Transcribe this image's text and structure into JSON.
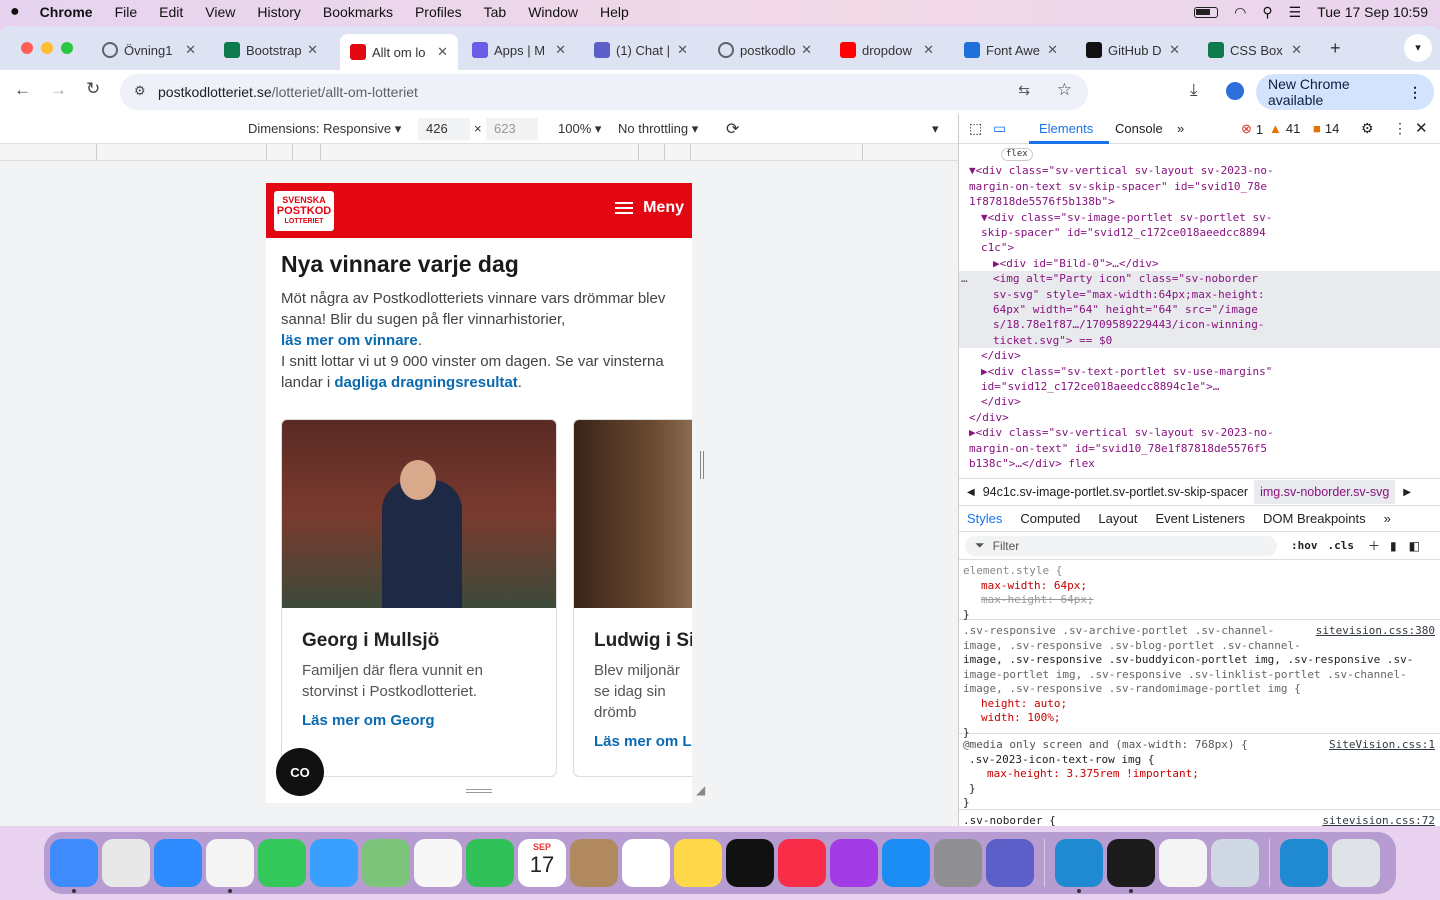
{
  "menubar": {
    "app": "Chrome",
    "items": [
      "File",
      "Edit",
      "View",
      "History",
      "Bookmarks",
      "Profiles",
      "Tab",
      "Window",
      "Help"
    ],
    "datetime": "Tue 17 Sep  10:59"
  },
  "tabs": [
    {
      "title": "Övning1",
      "icon": "globe-icon",
      "color": "#5f6368"
    },
    {
      "title": "Bootstrap",
      "icon": "w-icon",
      "color": "#0c7a4d"
    },
    {
      "title": "Allt om lo",
      "icon": "postkod-icon",
      "color": "#e30613",
      "active": true
    },
    {
      "title": "Apps | M",
      "icon": "copilot-icon",
      "color": "#6c5ce7"
    },
    {
      "title": "(1) Chat |",
      "icon": "teams-icon",
      "color": "#5b5fc7"
    },
    {
      "title": "postkodlo",
      "icon": "globe-icon",
      "color": "#5f6368"
    },
    {
      "title": "dropdow",
      "icon": "youtube-icon",
      "color": "#ff0000"
    },
    {
      "title": "Font Awe",
      "icon": "flag-icon",
      "color": "#1e6fd9"
    },
    {
      "title": "GitHub D",
      "icon": "github-icon",
      "color": "#111111"
    },
    {
      "title": "CSS Box",
      "icon": "w-icon",
      "color": "#0c7a4d"
    }
  ],
  "address": {
    "host": "postkodlotteriet.se",
    "path": "/lotteriet/allt-om-lotteriet"
  },
  "toolbar": {
    "new_chrome": "New Chrome available"
  },
  "devbar": {
    "dimensions": "Dimensions: Responsive",
    "width": "426",
    "height": "623",
    "zoom": "100%",
    "throttle": "No throttling"
  },
  "site": {
    "logo": {
      "l1": "SVENSKA",
      "l2": "POSTKOD",
      "l3": "LOTTERIET"
    },
    "menu": "Meny",
    "heading": "Nya vinnare varje dag",
    "intro1": "Möt några av Postkodlotteriets vinnare vars drömmar blev sanna! Blir du sugen på fler vinnarhistorier,",
    "link1": "läs mer om vinnare",
    "intro2": "I snitt lottar vi ut 9 000 vinster om dagen. Se var vinsterna landar i",
    "link2": "dagliga dragningsresultat",
    "cards": [
      {
        "name": "Georg i Mullsjö",
        "desc": "Familjen där flera vunnit en storvinst i Postkodlotteriet.",
        "more": "Läs mer om Georg"
      },
      {
        "name": "Ludwig i Sir",
        "desc": "Blev miljonär se idag sin drömb",
        "more": "Läs mer om Lu"
      }
    ],
    "co_button": "CO"
  },
  "devtools": {
    "tabs": [
      "Elements",
      "Console"
    ],
    "errors": "1",
    "warnings": "41",
    "issues": "14",
    "crumb1": "94c1c.sv-image-portlet.sv-portlet.sv-skip-spacer",
    "crumb2": "img.sv-noborder.sv-svg",
    "style_tabs": [
      "Styles",
      "Computed",
      "Layout",
      "Event Listeners",
      "DOM Breakpoints"
    ],
    "filter": "Filter",
    "hov": ":hov",
    "cls": ".cls"
  },
  "dom_lines": [
    {
      "indent": 172,
      "text": "flex",
      "pill": true
    },
    {
      "indent": 140,
      "text": "▼<div class=\"sv-vertical sv-layout sv-2023-no-"
    },
    {
      "indent": 140,
      "text": "margin-on-text sv-skip-spacer\" id=\"svid10_78e"
    },
    {
      "indent": 140,
      "text": "1f87818de5576f5b138b\">"
    },
    {
      "indent": 152,
      "text": "▼<div class=\"sv-image-portlet sv-portlet sv-"
    },
    {
      "indent": 152,
      "text": "skip-spacer\" id=\"svid12_c172ce018aeedcc8894"
    },
    {
      "indent": 152,
      "text": "c1c\">"
    },
    {
      "indent": 164,
      "text": "▶<div id=\"Bild-0\">…</div>"
    },
    {
      "indent": 164,
      "text": "<img alt=\"Party icon\" class=\"sv-noborder",
      "hl": true
    },
    {
      "indent": 164,
      "text": "sv-svg\" style=\"max-width:64px;max-height:",
      "hl": true
    },
    {
      "indent": 164,
      "text": "64px\" width=\"64\" height=\"64\" src=\"/image",
      "hl": true
    },
    {
      "indent": 164,
      "text": "s/18.78e1f87…/1709589229443/icon-winning-",
      "hl": true
    },
    {
      "indent": 164,
      "text": "ticket.svg\"> == $0",
      "hl": true
    },
    {
      "indent": 152,
      "text": "</div>"
    },
    {
      "indent": 152,
      "text": "▶<div class=\"sv-text-portlet sv-use-margins\""
    },
    {
      "indent": 152,
      "text": "id=\"svid12_c172ce018aeedcc8894c1e\">…"
    },
    {
      "indent": 152,
      "text": "</div>"
    },
    {
      "indent": 140,
      "text": "</div>"
    },
    {
      "indent": 140,
      "text": "▶<div class=\"sv-vertical sv-layout sv-2023-no-"
    },
    {
      "indent": 140,
      "text": "margin-on-text\" id=\"svid10_78e1f87818de5576f5"
    },
    {
      "indent": 140,
      "text": "b138c\">…</div> flex"
    }
  ],
  "styles": {
    "rule1_selector": "element.style {",
    "rule1_p1": "max-width: 64px;",
    "rule1_p2": "max-height: 64px;",
    "rule2_src": "sitevision.css:380",
    "rule2_sel1": ".sv-responsive .sv-archive-portlet .sv-channel-",
    "rule2_sel2": "image, .sv-responsive .sv-blog-portlet .sv-channel-",
    "rule2_sel3": "image, .sv-responsive .sv-buddyicon-portlet img, .sv-responsive .sv-",
    "rule2_sel4": "image-portlet img, .sv-responsive .sv-linklist-portlet .sv-channel-",
    "rule2_sel5": "image, .sv-responsive .sv-randomimage-portlet img {",
    "rule2_p1": "height: auto;",
    "rule2_p2": "width: 100%;",
    "rule3_src": "SiteVision.css:1",
    "rule3_media": "@media only screen and (max-width: 768px) {",
    "rule3_sel": ".sv-2023-icon-text-row img {",
    "rule3_p1": "max-height: 3.375rem !important;",
    "rule4_sel": ".sv-noborder {",
    "rule4_src": "sitevision.css:72"
  },
  "dock": [
    {
      "name": "finder-icon",
      "color": "#3d8bfd"
    },
    {
      "name": "launchpad-icon",
      "color": "#e8e8e8"
    },
    {
      "name": "safari-icon",
      "color": "#2f8cff"
    },
    {
      "name": "chrome-icon",
      "color": "#f4f4f4"
    },
    {
      "name": "messages-icon",
      "color": "#34c759"
    },
    {
      "name": "mail-icon",
      "color": "#3aa0ff"
    },
    {
      "name": "maps-icon",
      "color": "#7cc47a"
    },
    {
      "name": "photos-icon",
      "color": "#f7f7f7"
    },
    {
      "name": "facetime-icon",
      "color": "#30c158"
    },
    {
      "name": "calendar-icon",
      "color": "#ffffff"
    },
    {
      "name": "contacts-icon",
      "color": "#b08a5e"
    },
    {
      "name": "reminders-icon",
      "color": "#ffffff"
    },
    {
      "name": "notes-icon",
      "color": "#ffd84a"
    },
    {
      "name": "appletv-icon",
      "color": "#111111"
    },
    {
      "name": "music-icon",
      "color": "#fa2d48"
    },
    {
      "name": "podcasts-icon",
      "color": "#a23ce6"
    },
    {
      "name": "appstore-icon",
      "color": "#1c8df5"
    },
    {
      "name": "settings-icon",
      "color": "#8e8e93"
    },
    {
      "name": "teams-icon",
      "color": "#5b5fc7"
    },
    {
      "name": "vscode-icon",
      "color": "#1f8ad2"
    },
    {
      "name": "terminal-icon",
      "color": "#1b1b1b"
    },
    {
      "name": "textedit-icon",
      "color": "#f4f4f4"
    },
    {
      "name": "preview-icon",
      "color": "#cfd8e3"
    },
    {
      "name": "vscode-icon",
      "color": "#1f8ad2"
    },
    {
      "name": "trash-icon",
      "color": "#dfe3e8"
    }
  ],
  "calendar": {
    "month": "SEP",
    "day": "17"
  }
}
